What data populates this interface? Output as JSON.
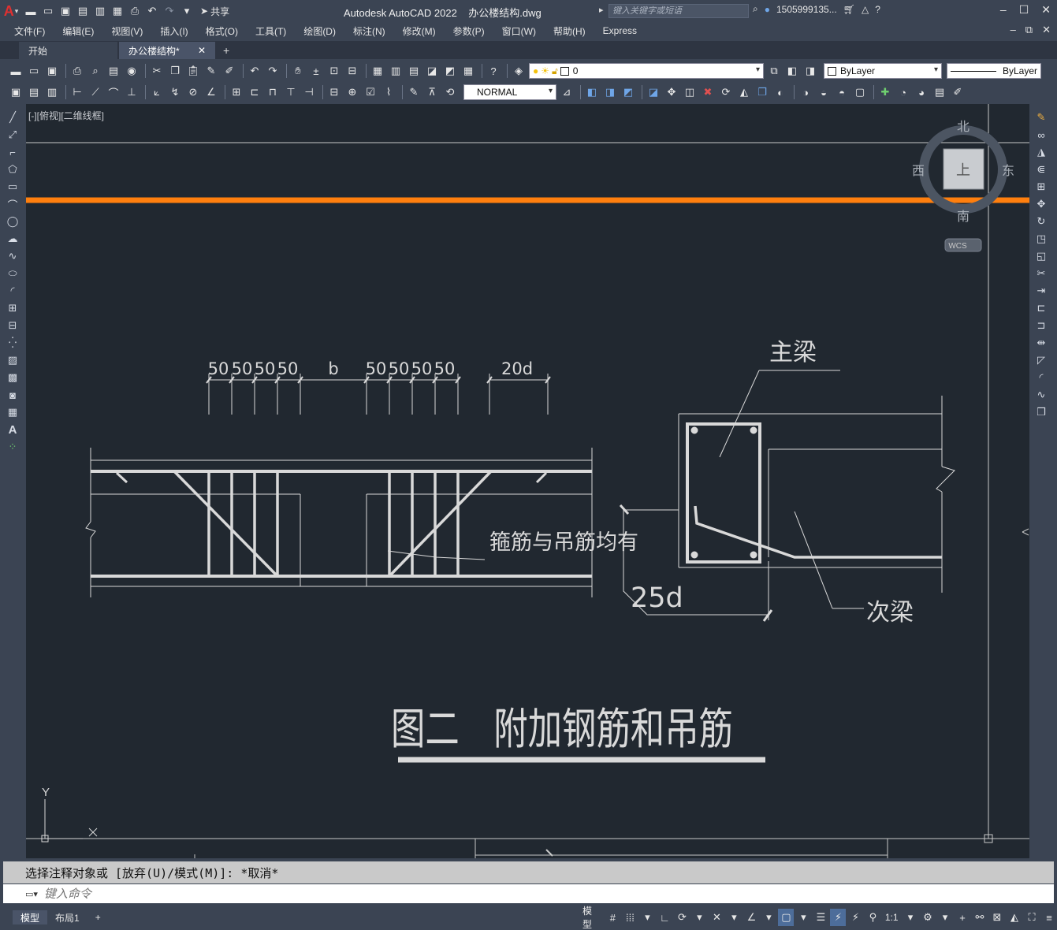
{
  "title": {
    "app_name": "Autodesk AutoCAD 2022",
    "file_name": "办公楼结构.dwg",
    "search_placeholder": "键入关键字或短语",
    "user": "1505999135...",
    "share": "共享"
  },
  "menu": [
    "文件(F)",
    "编辑(E)",
    "视图(V)",
    "插入(I)",
    "格式(O)",
    "工具(T)",
    "绘图(D)",
    "标注(N)",
    "修改(M)",
    "参数(P)",
    "窗口(W)",
    "帮助(H)",
    "Express"
  ],
  "tabs": {
    "start": "开始",
    "active": "办公楼结构*",
    "close": "✕",
    "add": "+"
  },
  "toolbar": {
    "layer_value": "0",
    "color_value": "ByLayer",
    "linetype_value": "ByLayer",
    "dimstyle_value": "NORMAL"
  },
  "viewport": {
    "label": "[-][俯视][二维线框]"
  },
  "viewcube": {
    "north": "北",
    "south": "南",
    "east": "东",
    "west": "西",
    "top": "上",
    "wcs": "WCS"
  },
  "drawing": {
    "dims_left": [
      "50",
      "50",
      "50",
      "50"
    ],
    "dim_b": "b",
    "dims_right": [
      "50",
      "50",
      "50",
      "50"
    ],
    "dim_20d": "20d",
    "dim_25d": "25d",
    "label_main_beam": "主梁",
    "label_secondary_beam": "次梁",
    "label_note": "箍筋与吊筋均有",
    "figure_title": "图二　附加钢筋和吊筋",
    "ucs_y": "Y",
    "ucs_x": "X"
  },
  "command": {
    "history": "选择注释对象或 [放弃(U)/模式(M)]: *取消*",
    "placeholder": "键入命令"
  },
  "status": {
    "layout_model": "模型",
    "layout_1": "布局1",
    "layout_add": "+",
    "model_btn": "模型",
    "scale": "1:1"
  },
  "colors": {
    "orange_line": "#ff7f0e",
    "canvas_bg": "#212830",
    "drawing_line": "#d9d9d9"
  }
}
